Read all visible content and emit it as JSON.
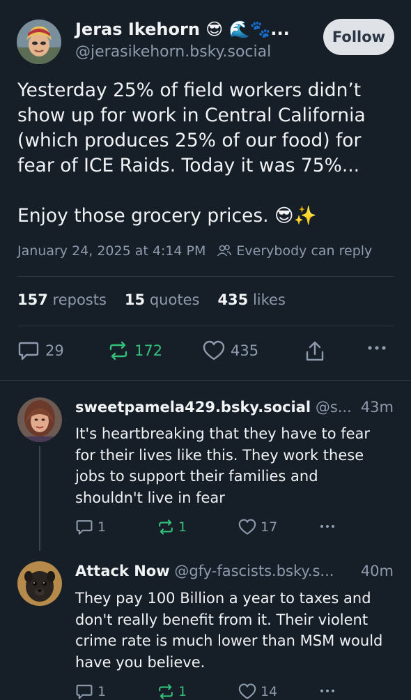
{
  "post": {
    "author_name": "Jeras Ikehorn 😎 🌊🐾...",
    "handle": "@jerasikehorn.bsky.social",
    "follow_label": "Follow",
    "text_line1": "Yesterday 25% of field workers didn’t show up for work in Central California (which produces 25% of our food) for fear of ICE Raids.  Today it was 75%...",
    "text_line2": "Enjoy those grocery prices. 😎✨",
    "timestamp": "January 24, 2025 at 4:14 PM",
    "reply_setting": "Everybody can reply",
    "reposts_count": "157",
    "reposts_label": "reposts",
    "quotes_count": "15",
    "quotes_label": "quotes",
    "likes_count": "435",
    "likes_label": "likes",
    "reply_count": "29",
    "repost_count": "172",
    "like_count": "435"
  },
  "replies": [
    {
      "name": "sweetpamela429.bsky.social",
      "handle": "@s...",
      "time": "43m",
      "text": "It's heartbreaking that they have to fear for their lives like this. They work these jobs to support their families and shouldn't live in fear",
      "reply_count": "1",
      "repost_count": "1",
      "like_count": "17"
    },
    {
      "name": "Attack Now",
      "handle": "@gfy-fascists.bsky.s...",
      "time": "40m",
      "text": "They pay 100 Billion a year to taxes and don't really benefit from it.  Their violent crime rate is much lower than MSM would have you believe.",
      "reply_count": "1",
      "repost_count": "1",
      "like_count": "14"
    }
  ],
  "colors": {
    "background": "#161e27",
    "muted": "#8d9bad",
    "repost_green": "#33c07a",
    "divider": "#2b3744"
  },
  "icons": [
    "reply-icon",
    "repost-icon",
    "like-icon",
    "share-icon",
    "more-icon",
    "people-icon"
  ]
}
